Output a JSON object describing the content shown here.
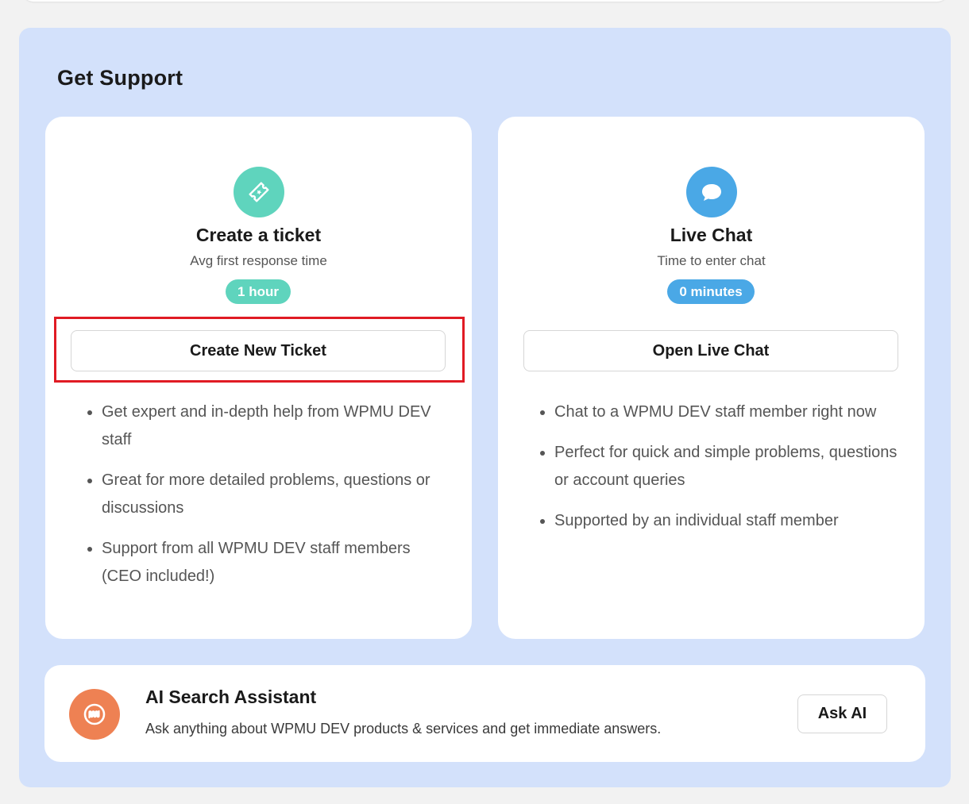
{
  "support": {
    "title": "Get Support",
    "ticket": {
      "icon": "ticket-icon",
      "title": "Create a ticket",
      "subtitle": "Avg first response time",
      "badge": "1 hour",
      "button_label": "Create New Ticket",
      "features": [
        "Get expert and in-depth help from WPMU DEV staff",
        "Great for more detailed problems, questions or discussions",
        "Support from all WPMU DEV staff members (CEO included!)"
      ],
      "accent_color": "#5fd4bd",
      "highlighted": true,
      "highlight_color": "#e01b24"
    },
    "chat": {
      "icon": "chat-bubble-icon",
      "title": "Live Chat",
      "subtitle": "Time to enter chat",
      "badge": "0 minutes",
      "button_label": "Open Live Chat",
      "features": [
        "Chat to a WPMU DEV staff member right now",
        "Perfect for quick and simple problems, questions or account queries",
        "Supported by an individual staff member"
      ],
      "accent_color": "#4aa8e6"
    },
    "ai": {
      "icon": "ai-assistant-icon",
      "title": "AI Search Assistant",
      "description": "Ask anything about WPMU DEV products & services and get immediate answers.",
      "button_label": "Ask AI",
      "accent_color": "#ee8153"
    },
    "panel_color": "#d3e1fb"
  }
}
